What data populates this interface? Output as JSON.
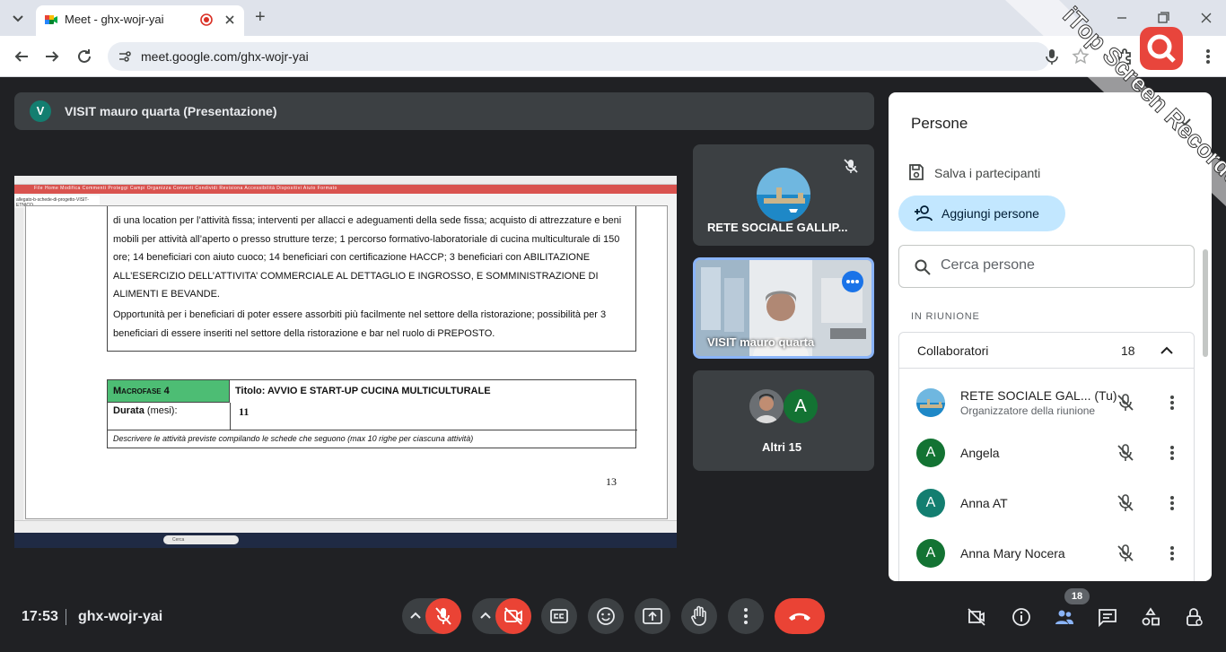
{
  "browser": {
    "tab_title": "Meet - ghx-wojr-yai",
    "url": "meet.google.com/ghx-wojr-yai",
    "new_tab_label": "+"
  },
  "presenter": {
    "avatar_letter": "V",
    "name": "VISIT mauro quarta (Presentazione)"
  },
  "presentation": {
    "ribbon_tabs": "File  Home  Modifica  Commenti  Proteggi  Campi  Organizza  Converti  Condividi  Revisiona  Accessibilità  Dispositivi  Aiuto  Formato",
    "doc_tab": "allegato-b-schede-di-progetto-VISIT-ETNICO",
    "paragraph1": "di una location per l’attività fissa; interventi per allacci e adeguamenti della sede fissa; acquisto di attrezzature e beni mobili per attività all’aperto o presso strutture terze; 1 percorso formativo-laboratoriale di cucina multiculturale di 150 ore; 14 beneficiari con aiuto cuoco; 14 beneficiari con certificazione HACCP; 3 beneficiari con ABILITAZIONE ALL’ESERCIZIO DELL’ATTIVITA’ COMMERCIALE AL DETTAGLIO E INGROSSO, E SOMMINISTRAZIONE DI ALIMENTI E BEVANDE.",
    "paragraph2": "Opportunità per i beneficiari di poter essere assorbiti più facilmente nel settore della ristorazione; possibilità per 3 beneficiari di essere inseriti nel settore della ristorazione e bar nel ruolo di PREPOSTO.",
    "macrofase_label": "Macrofase 4",
    "macrofase_title": "Titolo: AVVIO E START-UP CUCINA MULTICULTURALE",
    "durata_label": "Durata",
    "durata_unit": "(mesi):",
    "durata_value": "11",
    "description_hint": "Descrivere le attività previste compilando le schede che seguono (max 10 righe per ciascuna attività)",
    "page_number": "13",
    "taskbar_search": "Cerca"
  },
  "tiles": {
    "tile1_name": "RETE SOCIALE GALLIP...",
    "tile2_name": "VISIT mauro quarta",
    "tile3_avatar": "A",
    "tile3_label": "Altri 15"
  },
  "people_panel": {
    "title": "Persone",
    "save_participants": "Salva i partecipanti",
    "add_people": "Aggiungi persone",
    "search_placeholder": "Cerca persone",
    "section_in_meeting": "IN RIUNIONE",
    "group_label": "Collaboratori",
    "group_count": "18",
    "participants": [
      {
        "name": "RETE SOCIALE GAL... (Tu)",
        "subtitle": "Organizzatore della riunione",
        "avatar": "",
        "color": "#4a90c2"
      },
      {
        "name": "Angela",
        "subtitle": "",
        "avatar": "A",
        "color": "#137333"
      },
      {
        "name": "Anna AT",
        "subtitle": "",
        "avatar": "A",
        "color": "#137e70"
      },
      {
        "name": "Anna Mary Nocera",
        "subtitle": "",
        "avatar": "A",
        "color": "#137333"
      }
    ]
  },
  "bottom_bar": {
    "time": "17:53",
    "meeting_code": "ghx-wojr-yai",
    "people_count": "18"
  },
  "watermark": {
    "text": "iTop Screen Recorder"
  },
  "colors": {
    "meet_bg": "#202124",
    "tile_bg": "#3c4043",
    "danger": "#ea4335",
    "accent_blue": "#c2e7ff",
    "active_speaker": "#8ab4f8"
  }
}
